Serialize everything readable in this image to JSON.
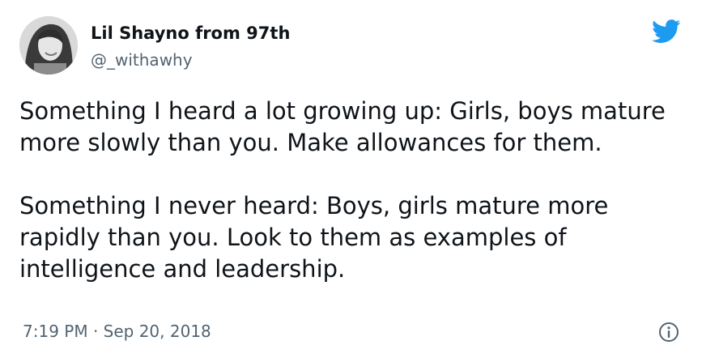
{
  "author": {
    "display_name": "Lil Shayno from 97th",
    "handle": "@_withawhy",
    "avatar_icon": "profile-photo"
  },
  "tweet": {
    "paragraphs": [
      "Something I heard a lot growing up: Girls, boys mature more slowly than you. Make allowances for them.",
      "Something I never heard: Boys, girls mature more rapidly than you. Look to them as examples of intelligence and leadership."
    ],
    "timestamp": "7:19 PM · Sep 20, 2018"
  },
  "icons": {
    "brand": "twitter-bird-icon",
    "info": "info-icon"
  },
  "colors": {
    "brand_blue": "#1d9bf0",
    "text_primary": "#0f1419",
    "text_secondary": "#536471"
  }
}
